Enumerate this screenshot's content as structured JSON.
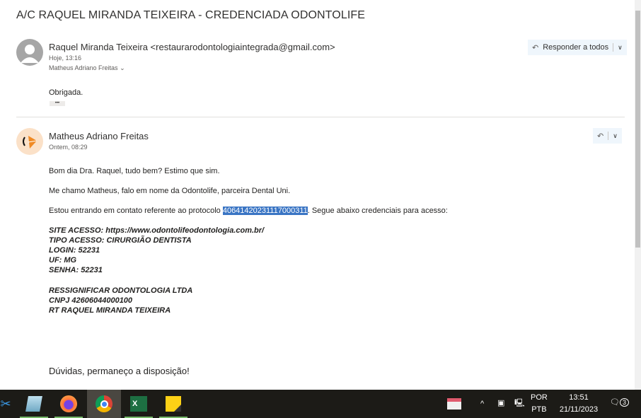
{
  "title": "A/C RAQUEL MIRANDA TEIXEIRA - CREDENCIADA ODONTOLIFE",
  "messages": [
    {
      "sender": "Raquel Miranda Teixeira <restaurarodontologiaintegrada@gmail.com>",
      "time": "Hoje, 13:16",
      "to": "Matheus Adriano Freitas",
      "body": "Obrigada.",
      "reply_label": "Responder a todos",
      "more": "•••"
    },
    {
      "sender": "Matheus Adriano Freitas",
      "time": "Ontem, 08:29",
      "greeting": "Bom dia Dra. Raquel, tudo bem? Estimo que sim.",
      "intro": "Me chamo Matheus, falo em nome da Odontolife, parceira Dental Uni.",
      "proto_pre": "Estou entrando em contato referente ao protocolo ",
      "protocol": "40641420231117000311",
      "proto_post": ". Segue abaixo credenciais para acesso:",
      "credentials": [
        "SITE ACESSO: https://www.odontolifeodontologia.com.br/",
        "TIPO ACESSO: CIRURGIÃO DENTISTA",
        "LOGIN: 52231",
        "UF: MG",
        "SENHA: 52231"
      ],
      "company": [
        "RESSIGNIFICAR ODONTOLOGIA LTDA",
        "CNPJ 42606044000100",
        "RT RAQUEL MIRANDA TEIXEIRA"
      ],
      "closing": "Dúvidas, permaneço a disposição!"
    }
  ],
  "taskbar": {
    "lang1": "POR",
    "lang2": "PTB",
    "time": "13:51",
    "date": "21/11/2023",
    "notifications": "3"
  }
}
